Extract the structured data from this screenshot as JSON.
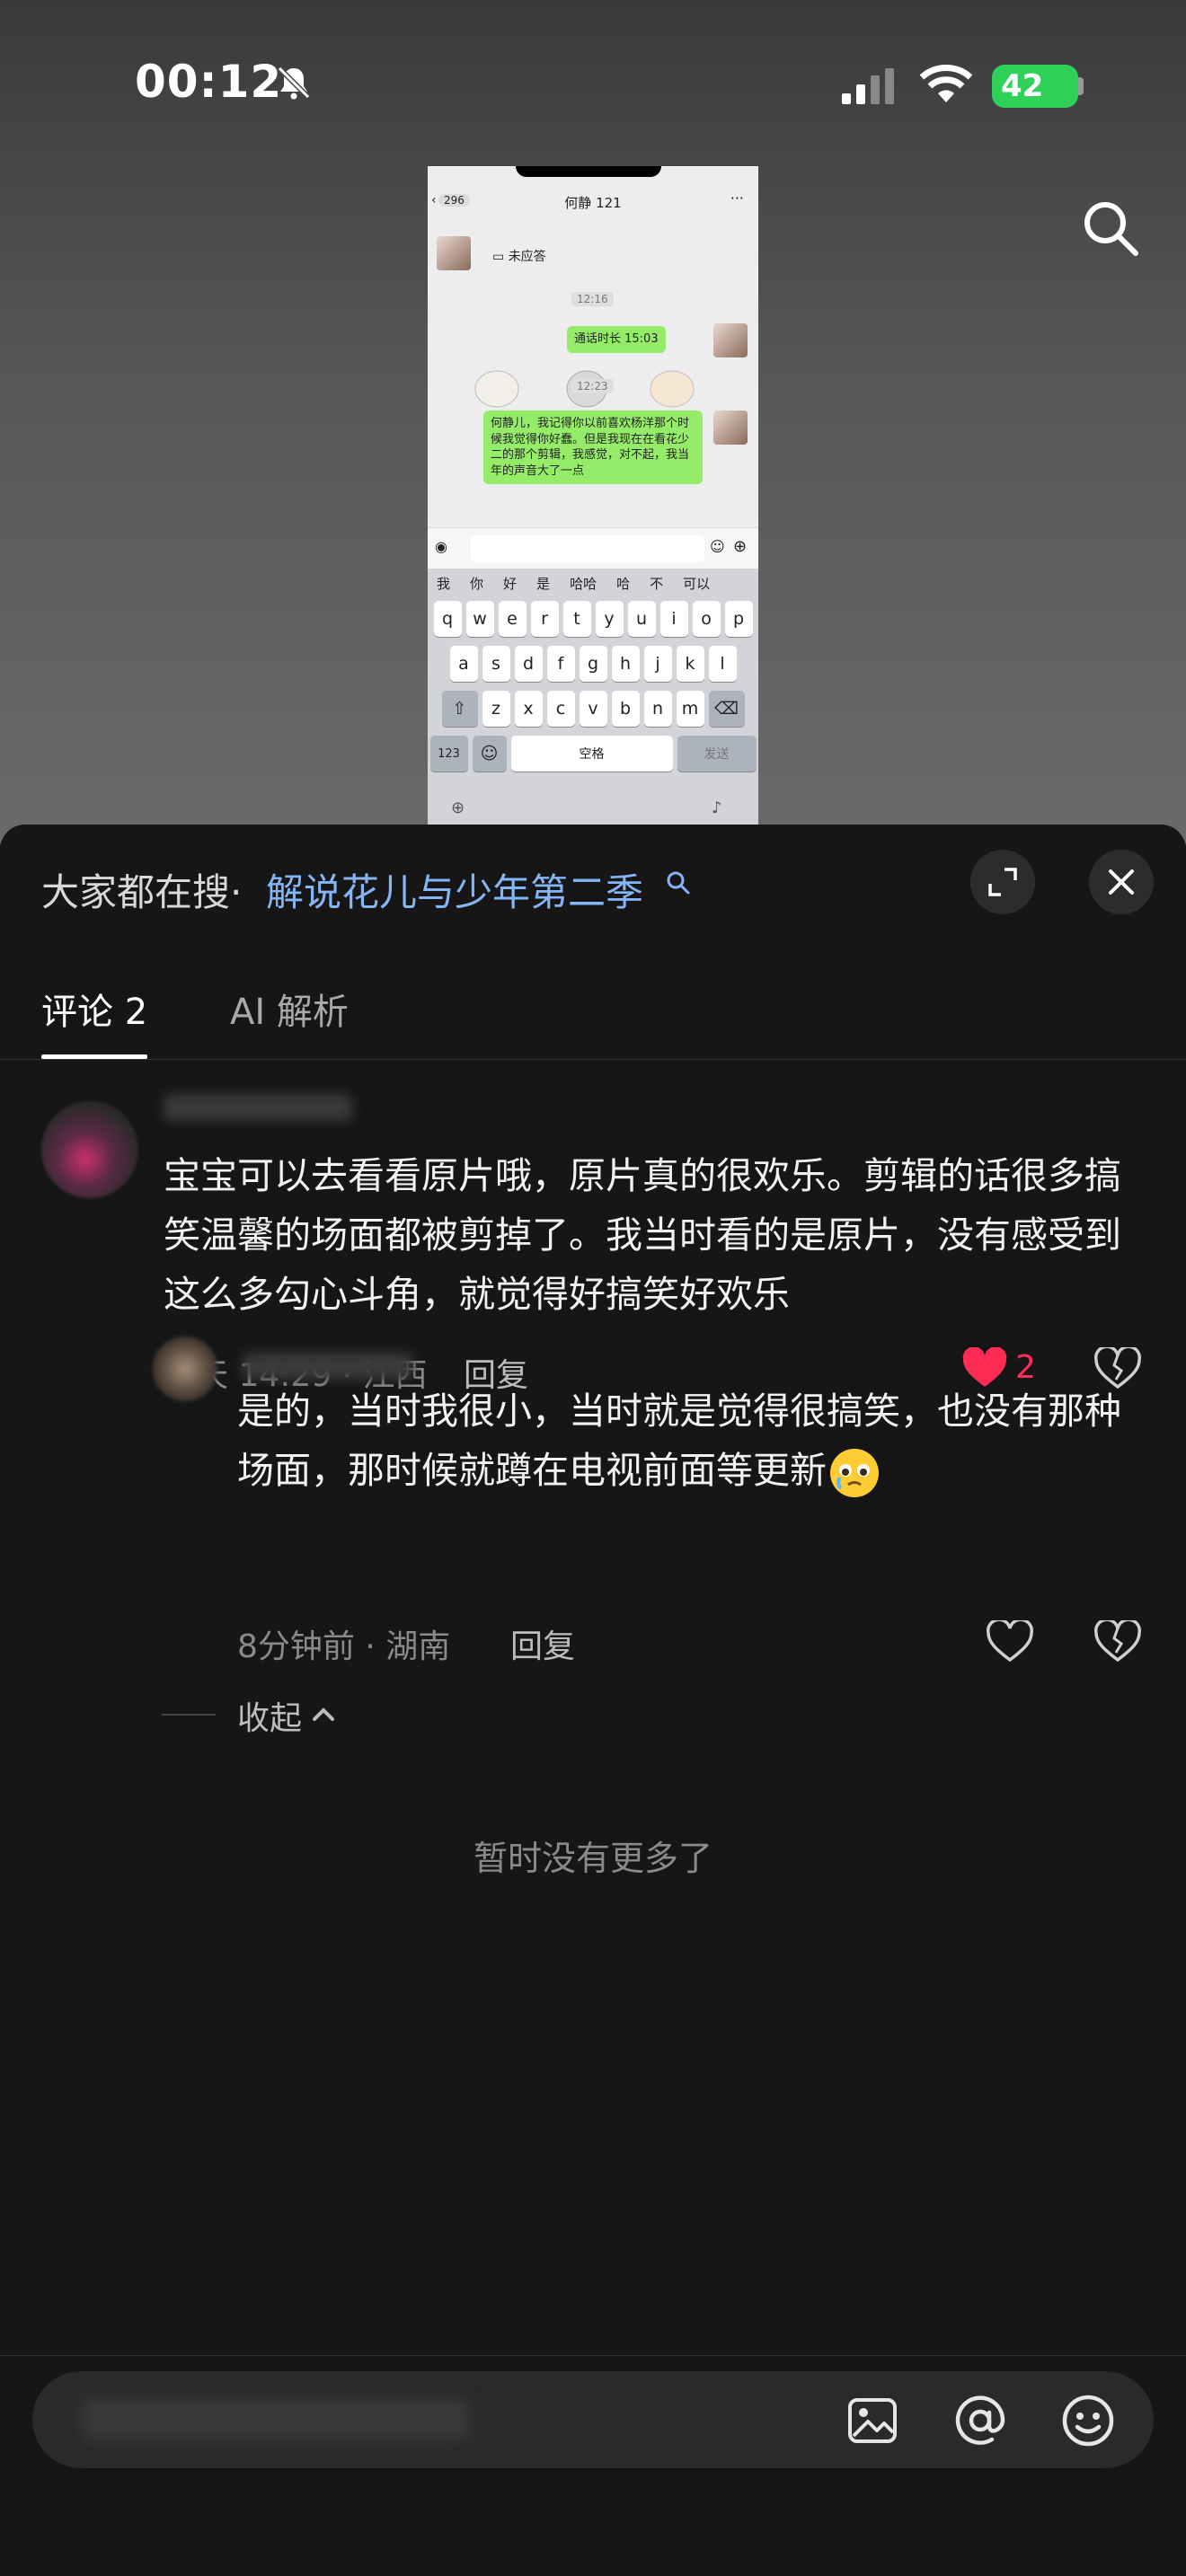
{
  "status_bar": {
    "time": "00:12",
    "battery": "42"
  },
  "embedded_chat": {
    "back_count": "296",
    "title": "何静 121",
    "missed_call": "未应答",
    "time_1": "12:16",
    "call_duration": "通话时长 15:03",
    "time_2": "12:23",
    "message": "何静儿，我记得你以前喜欢杨洋那个时候我觉得你好蠢。但是我现在在看花少二的那个剪辑，我感觉，对不起，我当年的声音大了一点",
    "suggestions": [
      "我",
      "你",
      "好",
      "是",
      "哈哈",
      "哈",
      "不",
      "可以"
    ],
    "keys_row1": [
      "q",
      "w",
      "e",
      "r",
      "t",
      "y",
      "u",
      "i",
      "o",
      "p"
    ],
    "keys_row2": [
      "a",
      "s",
      "d",
      "f",
      "g",
      "h",
      "j",
      "k",
      "l"
    ],
    "keys_row3": [
      "z",
      "x",
      "c",
      "v",
      "b",
      "n",
      "m"
    ],
    "key_123": "123",
    "key_space": "空格",
    "key_send": "发送"
  },
  "sheet": {
    "search_prefix": "大家都在搜·",
    "search_term": "解说花儿与少年第二季",
    "tabs": {
      "comments": "评论 2",
      "ai": "AI 解析"
    }
  },
  "comment": {
    "text": "宝宝可以去看看原片哦，原片真的很欢乐。剪辑的话很多搞笑温馨的场面都被剪掉了。我当时看的是原片，没有感受到这么多勾心斗角，就觉得好搞笑好欢乐",
    "time_location": "昨天 14:29 · 江西",
    "reply_label": "回复",
    "likes": "2"
  },
  "reply": {
    "text": "是的，当时我很小，当时就是觉得很搞笑，也没有那种场面，那时候就蹲在电视前面等更新",
    "time_location": "8分钟前 · 湖南",
    "reply_label": "回复"
  },
  "collapse_label": "收起",
  "no_more": "暂时没有更多了",
  "colors": {
    "accent_link": "#86b5f5",
    "like_red": "#fe2c55",
    "battery_green": "#30d158"
  }
}
